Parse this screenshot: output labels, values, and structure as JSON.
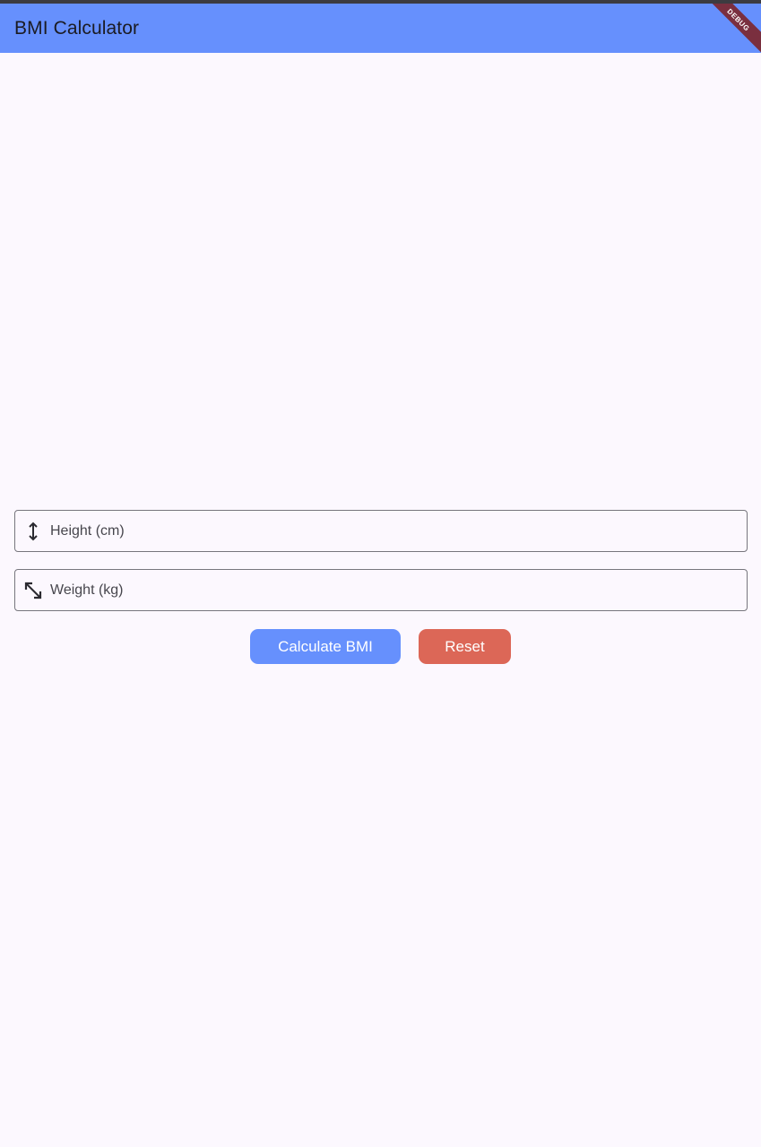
{
  "app_bar": {
    "title": "BMI Calculator",
    "debug_banner": "DEBUG",
    "color": "#6690fd"
  },
  "form": {
    "height_field": {
      "label": "Height (cm)",
      "value": "",
      "icon": "height-arrows-icon"
    },
    "weight_field": {
      "label": "Weight (kg)",
      "value": "",
      "icon": "diagonal-resize-icon"
    }
  },
  "buttons": {
    "calculate": {
      "label": "Calculate BMI",
      "color": "#6690fd"
    },
    "reset": {
      "label": "Reset",
      "color": "#dc6757"
    }
  }
}
